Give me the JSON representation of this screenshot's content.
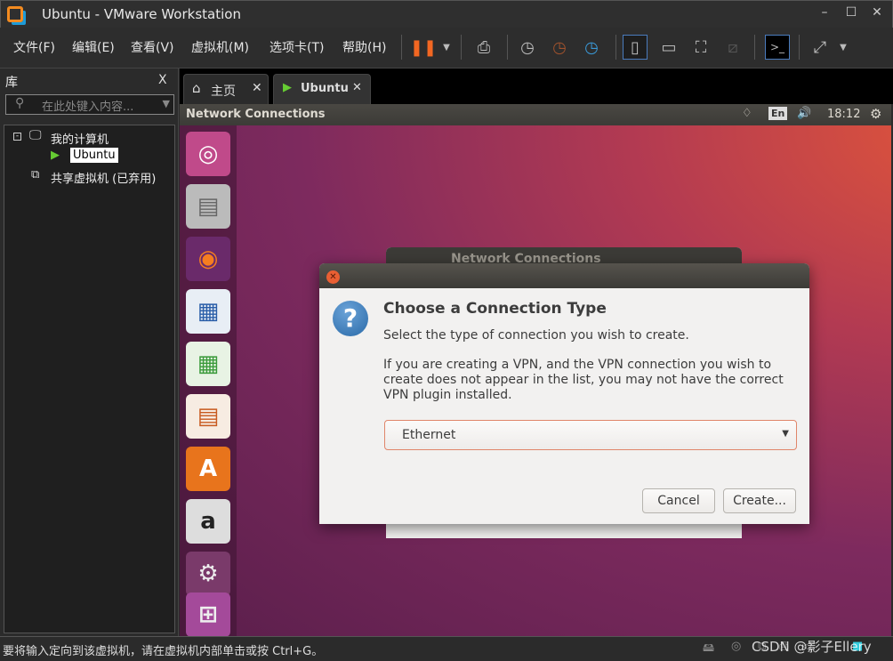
{
  "window": {
    "title": "Ubuntu - VMware Workstation",
    "minimize": "–",
    "maximize": "☐",
    "close": "✕"
  },
  "menu": [
    "文件(F)",
    "编辑(E)",
    "查看(V)",
    "虚拟机(M)",
    "选项卡(T)",
    "帮助(H)"
  ],
  "library": {
    "title": "库",
    "close": "X",
    "search_placeholder": "在此处键入内容...",
    "tree": {
      "my_computer": "我的计算机",
      "vm": "Ubuntu",
      "shared": "共享虚拟机 (已弃用)"
    }
  },
  "tabs": [
    {
      "label": "主页",
      "icon": "home-icon"
    },
    {
      "label": "Ubuntu",
      "icon": "vm-icon"
    }
  ],
  "ubuntu_bar": {
    "title": "Network Connections",
    "lang": "En",
    "time": "18:12"
  },
  "launcher": [
    "ubuntu-dash",
    "files",
    "firefox",
    "writer",
    "calc",
    "impress",
    "software-center",
    "amazon",
    "system-settings",
    "workspace-switcher"
  ],
  "back_dialog": {
    "title": "Network Connections"
  },
  "dialog": {
    "heading": "Choose a Connection Type",
    "subtitle": "Select the type of connection you wish to create.",
    "info": "If you are creating a VPN, and the VPN connection you wish to create does not appear in the list, you may not have the correct VPN plugin installed.",
    "selected_type": "Ethernet",
    "cancel": "Cancel",
    "create": "Create..."
  },
  "status": {
    "text": "要将输入定向到该虚拟机，请在虚拟机内部单击或按 Ctrl+G。",
    "watermark": "CSDN @影子Ellery"
  },
  "colors": {
    "accent": "#e95f33",
    "pause": "#f26722",
    "desktop": "#7d2a5e"
  }
}
